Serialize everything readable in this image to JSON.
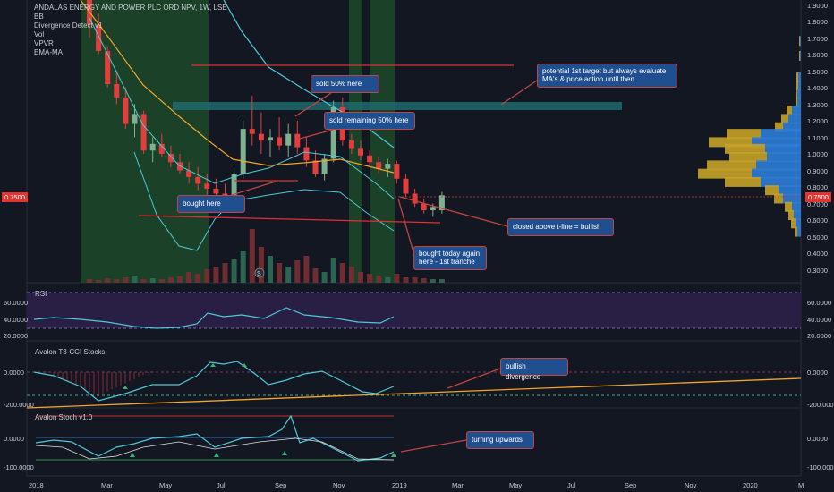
{
  "header": {
    "symbol_line": "ANDALAS ENERGY AND POWER PLC ORD NPV, 1W, LSE",
    "indicators": [
      "BB",
      "Divergence Detect v1",
      "Vol",
      "VPVR",
      "EMA-MA"
    ]
  },
  "panes": {
    "rsi": {
      "label": "RSI",
      "ticks": [
        "60.0000",
        "40.0000",
        "20.0000"
      ]
    },
    "cci": {
      "label": "Avalon T3-CCI Stocks",
      "ticks": [
        "0.0000",
        "-200.0000"
      ]
    },
    "stoch": {
      "label": "Avalon Stoch v1.0",
      "ticks": [
        "0.0000",
        "-100.0000"
      ]
    }
  },
  "price_axis": [
    "1.9000",
    "1.8000",
    "1.7000",
    "1.6000",
    "1.5000",
    "1.4000",
    "1.3000",
    "1.2000",
    "1.1000",
    "1.0000",
    "0.9000",
    "0.8000",
    "0.7000",
    "0.6000",
    "0.5000",
    "0.4000",
    "0.3000"
  ],
  "last_price": "0.7500",
  "time_axis": [
    "2018",
    "Mar",
    "May",
    "Jul",
    "Sep",
    "Nov",
    "2019",
    "Mar",
    "May",
    "Jul",
    "Sep",
    "Nov",
    "2020",
    "M"
  ],
  "annotations": {
    "sold_half": "sold 50% here",
    "sold_rest": "sold remaining 50% here",
    "bought_here": "bought here",
    "target": "potential 1st target but always evaluate MA's & price action until then",
    "closed_above": "closed above t-line = bullish",
    "bought_today": "bought today again here - 1st tranche",
    "bullish_div": "bullish divergence",
    "turning_up": "turning upwards"
  },
  "markers": {
    "volume_badge": "S"
  },
  "colors": {
    "background": "#131722",
    "up_candle": "#7fb08f",
    "down_candle": "#e23e3e",
    "bb_line": "#4dc9d6",
    "ema_line": "#f0a52b",
    "highlight_zone": "#1d4a2a",
    "callout_fill": "#1f4f8f",
    "callout_border": "#c2453f",
    "trendline": "#e03030",
    "vpvr_up": "#2e7cd6",
    "vpvr_down": "#c8a228",
    "rsi_band": "#2a1f47"
  },
  "chart_data": {
    "type": "candlestick",
    "title": "ANDALAS ENERGY AND POWER PLC ORD NPV, 1W, LSE",
    "ylim": [
      0.25,
      1.95
    ],
    "x_range_weeks": [
      0,
      60
    ],
    "candles": [
      {
        "w": 0,
        "o": 1.95,
        "h": 1.95,
        "l": 1.7,
        "c": 1.78
      },
      {
        "w": 1,
        "o": 1.78,
        "h": 1.85,
        "l": 1.6,
        "c": 1.62
      },
      {
        "w": 2,
        "o": 1.62,
        "h": 1.65,
        "l": 1.4,
        "c": 1.42
      },
      {
        "w": 3,
        "o": 1.42,
        "h": 1.5,
        "l": 1.3,
        "c": 1.34
      },
      {
        "w": 4,
        "o": 1.34,
        "h": 1.4,
        "l": 1.15,
        "c": 1.18
      },
      {
        "w": 5,
        "o": 1.18,
        "h": 1.3,
        "l": 1.1,
        "c": 1.24
      },
      {
        "w": 6,
        "o": 1.24,
        "h": 1.26,
        "l": 1.0,
        "c": 1.02
      },
      {
        "w": 7,
        "o": 1.02,
        "h": 1.1,
        "l": 0.95,
        "c": 1.06
      },
      {
        "w": 8,
        "o": 1.06,
        "h": 1.12,
        "l": 0.98,
        "c": 1.0
      },
      {
        "w": 9,
        "o": 1.0,
        "h": 1.05,
        "l": 0.92,
        "c": 0.95
      },
      {
        "w": 10,
        "o": 0.95,
        "h": 1.0,
        "l": 0.88,
        "c": 0.9
      },
      {
        "w": 11,
        "o": 0.9,
        "h": 0.95,
        "l": 0.82,
        "c": 0.86
      },
      {
        "w": 12,
        "o": 0.86,
        "h": 0.92,
        "l": 0.78,
        "c": 0.82
      },
      {
        "w": 13,
        "o": 0.82,
        "h": 0.88,
        "l": 0.74,
        "c": 0.79
      },
      {
        "w": 14,
        "o": 0.79,
        "h": 0.85,
        "l": 0.72,
        "c": 0.76
      },
      {
        "w": 15,
        "o": 0.76,
        "h": 0.82,
        "l": 0.7,
        "c": 0.74
      },
      {
        "w": 16,
        "o": 0.74,
        "h": 0.9,
        "l": 0.72,
        "c": 0.88
      },
      {
        "w": 17,
        "o": 0.88,
        "h": 1.2,
        "l": 0.85,
        "c": 1.15
      },
      {
        "w": 18,
        "o": 1.15,
        "h": 1.35,
        "l": 1.05,
        "c": 1.12
      },
      {
        "w": 19,
        "o": 1.12,
        "h": 1.25,
        "l": 1.0,
        "c": 1.08
      },
      {
        "w": 20,
        "o": 1.08,
        "h": 1.15,
        "l": 0.98,
        "c": 1.1
      },
      {
        "w": 21,
        "o": 1.1,
        "h": 1.22,
        "l": 1.02,
        "c": 1.05
      },
      {
        "w": 22,
        "o": 1.05,
        "h": 1.18,
        "l": 0.98,
        "c": 1.12
      },
      {
        "w": 23,
        "o": 1.12,
        "h": 1.2,
        "l": 1.0,
        "c": 1.04
      },
      {
        "w": 24,
        "o": 1.04,
        "h": 1.1,
        "l": 0.92,
        "c": 0.96
      },
      {
        "w": 25,
        "o": 0.96,
        "h": 1.02,
        "l": 0.86,
        "c": 0.88
      },
      {
        "w": 26,
        "o": 0.88,
        "h": 1.0,
        "l": 0.84,
        "c": 0.97
      },
      {
        "w": 27,
        "o": 0.97,
        "h": 1.32,
        "l": 0.95,
        "c": 1.28
      },
      {
        "w": 28,
        "o": 1.28,
        "h": 1.34,
        "l": 1.05,
        "c": 1.08
      },
      {
        "w": 29,
        "o": 1.08,
        "h": 1.12,
        "l": 1.0,
        "c": 1.03
      },
      {
        "w": 30,
        "o": 1.03,
        "h": 1.08,
        "l": 0.96,
        "c": 0.99
      },
      {
        "w": 31,
        "o": 0.99,
        "h": 1.02,
        "l": 0.92,
        "c": 0.95
      },
      {
        "w": 32,
        "o": 0.95,
        "h": 0.98,
        "l": 0.88,
        "c": 0.91
      },
      {
        "w": 33,
        "o": 0.91,
        "h": 0.97,
        "l": 0.86,
        "c": 0.94
      },
      {
        "w": 34,
        "o": 0.94,
        "h": 0.96,
        "l": 0.82,
        "c": 0.85
      },
      {
        "w": 35,
        "o": 0.85,
        "h": 0.88,
        "l": 0.74,
        "c": 0.76
      },
      {
        "w": 36,
        "o": 0.76,
        "h": 0.79,
        "l": 0.68,
        "c": 0.7
      },
      {
        "w": 37,
        "o": 0.7,
        "h": 0.73,
        "l": 0.64,
        "c": 0.66
      },
      {
        "w": 38,
        "o": 0.66,
        "h": 0.7,
        "l": 0.62,
        "c": 0.68
      },
      {
        "w": 39,
        "o": 0.66,
        "h": 0.77,
        "l": 0.64,
        "c": 0.75
      }
    ]
  }
}
